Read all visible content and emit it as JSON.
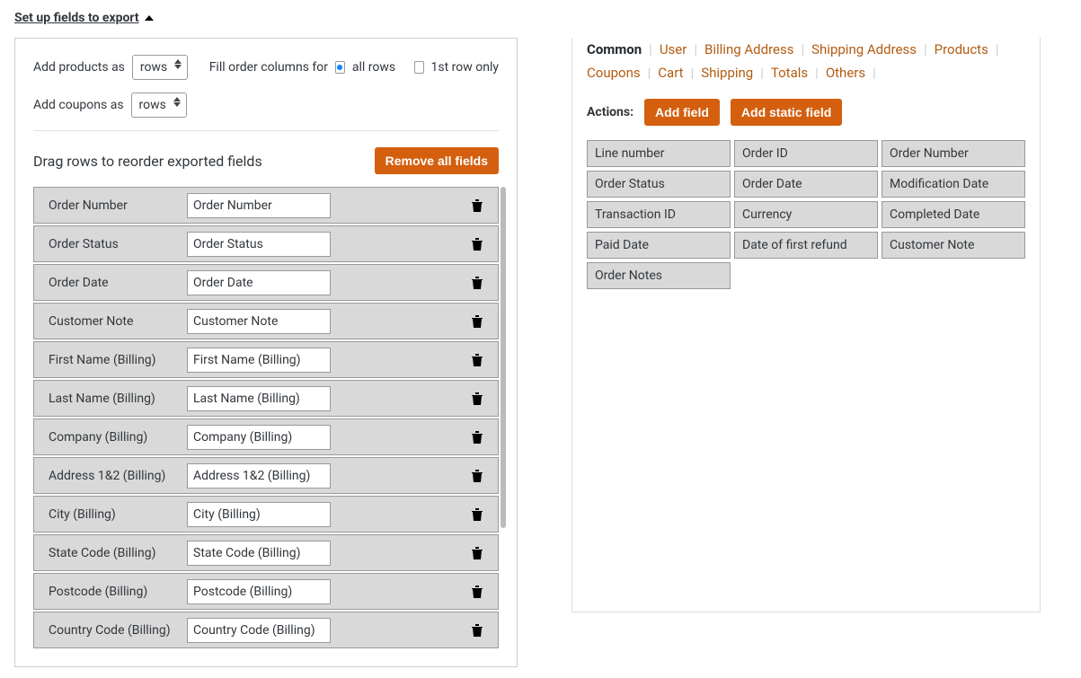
{
  "section_title": "Set up fields to export",
  "left": {
    "add_products_label": "Add products as",
    "products_value": "rows",
    "fill_label": "Fill order columns for",
    "fill_option_all": "all rows",
    "fill_option_first": "1st row only",
    "add_coupons_label": "Add coupons as",
    "coupons_value": "rows",
    "reorder_title": "Drag rows to reorder exported fields",
    "remove_all": "Remove all fields",
    "fields": [
      {
        "label": "Order Number",
        "value": "Order Number"
      },
      {
        "label": "Order Status",
        "value": "Order Status"
      },
      {
        "label": "Order Date",
        "value": "Order Date"
      },
      {
        "label": "Customer Note",
        "value": "Customer Note"
      },
      {
        "label": "First Name (Billing)",
        "value": "First Name (Billing)"
      },
      {
        "label": "Last Name (Billing)",
        "value": "Last Name (Billing)"
      },
      {
        "label": "Company (Billing)",
        "value": "Company (Billing)"
      },
      {
        "label": "Address 1&2 (Billing)",
        "value": "Address 1&2 (Billing)"
      },
      {
        "label": "City (Billing)",
        "value": "City (Billing)"
      },
      {
        "label": "State Code (Billing)",
        "value": "State Code (Billing)"
      },
      {
        "label": "Postcode (Billing)",
        "value": "Postcode (Billing)"
      },
      {
        "label": "Country Code (Billing)",
        "value": "Country Code (Billing)"
      }
    ]
  },
  "right": {
    "tabs": [
      "Common",
      "User",
      "Billing Address",
      "Shipping Address",
      "Products",
      "Coupons",
      "Cart",
      "Shipping",
      "Totals",
      "Others"
    ],
    "active_tab": "Common",
    "actions_label": "Actions:",
    "add_field": "Add field",
    "add_static": "Add static field",
    "available": [
      "Line number",
      "Order ID",
      "Order Number",
      "Order Status",
      "Order Date",
      "Modification Date",
      "Transaction ID",
      "Currency",
      "Completed Date",
      "Paid Date",
      "Date of first refund",
      "Customer Note",
      "Order Notes"
    ]
  }
}
